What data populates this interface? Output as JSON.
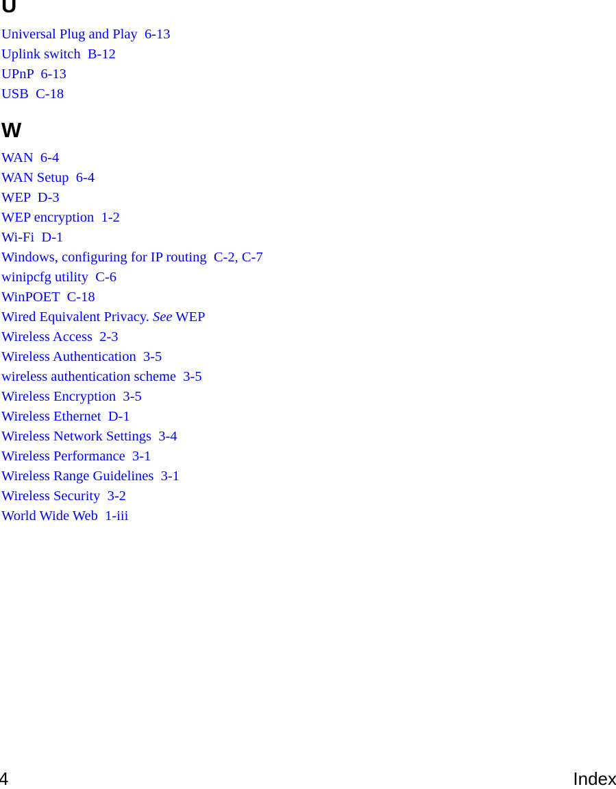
{
  "document": {
    "kind": "index-page",
    "page_number": "4",
    "footer_label": "Index",
    "text_color": "#0000ff",
    "heading_color": "#000000",
    "background_color": "#ffffff"
  },
  "sections": [
    {
      "letter": "U",
      "entries": [
        {
          "text": "Universal Plug and Play  6-13"
        },
        {
          "text": "Uplink switch  B-12"
        },
        {
          "text": "UPnP  6-13"
        },
        {
          "text": "USB  C-18"
        }
      ]
    },
    {
      "letter": "W",
      "entries": [
        {
          "text": "WAN  6-4"
        },
        {
          "text": "WAN Setup  6-4"
        },
        {
          "text": "WEP  D-3"
        },
        {
          "text": "WEP encryption  1-2"
        },
        {
          "text": "Wi-Fi  D-1"
        },
        {
          "text": "Windows, configuring for IP routing  C-2, C-7"
        },
        {
          "text": "winipcfg utility  C-6"
        },
        {
          "text": "WinPOET  C-18"
        },
        {
          "text": "Wired Equivalent Privacy. ",
          "italic": "See",
          "after": " WEP"
        },
        {
          "text": "Wireless Access  2-3"
        },
        {
          "text": "Wireless Authentication  3-5"
        },
        {
          "text": "wireless authentication scheme  3-5"
        },
        {
          "text": "Wireless Encryption  3-5"
        },
        {
          "text": "Wireless Ethernet  D-1"
        },
        {
          "text": "Wireless Network Settings  3-4"
        },
        {
          "text": "Wireless Performance  3-1"
        },
        {
          "text": "Wireless Range Guidelines  3-1"
        },
        {
          "text": "Wireless Security  3-2"
        },
        {
          "text": "World Wide Web  1-iii"
        }
      ]
    }
  ]
}
